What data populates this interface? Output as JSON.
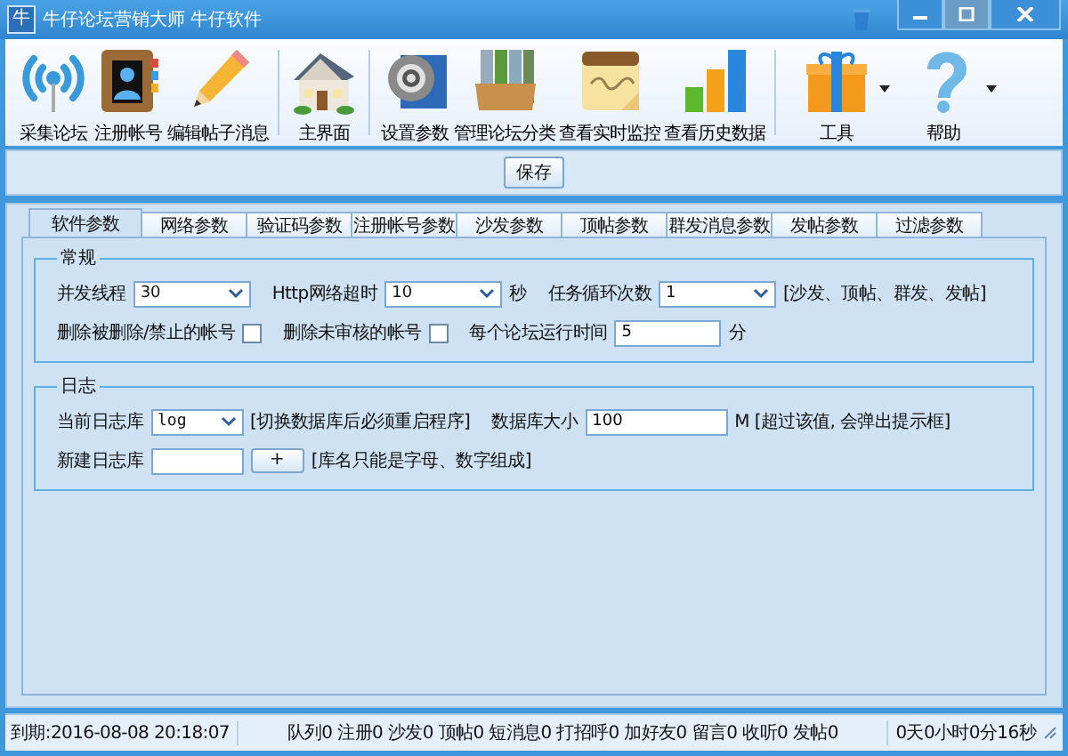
{
  "window": {
    "app_icon_text": "牛",
    "title": "牛仔论坛营销大师 牛仔软件"
  },
  "toolbar": {
    "groups": [
      [
        {
          "label": "采集论坛",
          "dropdown": false
        },
        {
          "label": "注册帐号",
          "dropdown": false
        },
        {
          "label": "编辑帖子消息",
          "dropdown": false
        }
      ],
      [
        {
          "label": "主界面",
          "dropdown": false
        }
      ],
      [
        {
          "label": "设置参数",
          "dropdown": false
        },
        {
          "label": "管理论坛分类",
          "dropdown": false
        },
        {
          "label": "查看实时监控",
          "dropdown": false
        },
        {
          "label": "查看历史数据",
          "dropdown": false
        }
      ],
      [
        {
          "label": "工具",
          "dropdown": true
        },
        {
          "label": "帮助",
          "dropdown": true
        }
      ]
    ]
  },
  "save_button": "保存",
  "tabs": [
    {
      "label": "软件参数",
      "selected": true
    },
    {
      "label": "网络参数",
      "selected": false
    },
    {
      "label": "验证码参数",
      "selected": false
    },
    {
      "label": "注册帐号参数",
      "selected": false
    },
    {
      "label": "沙发参数",
      "selected": false
    },
    {
      "label": "顶帖参数",
      "selected": false
    },
    {
      "label": "群发消息参数",
      "selected": false
    },
    {
      "label": "发帖参数",
      "selected": false
    },
    {
      "label": "过滤参数",
      "selected": false
    }
  ],
  "general": {
    "title": "常规",
    "threads": {
      "label": "并发线程",
      "value": "30"
    },
    "http_timeout": {
      "label": "Http网络超时",
      "value": "10",
      "unit": "秒"
    },
    "loop_count": {
      "label": "任务循环次数",
      "value": "1",
      "note": "[沙发、顶帖、群发、发帖]"
    },
    "delete_banned": {
      "label": "删除被删除/禁止的帐号",
      "checked": false
    },
    "delete_unreviewed": {
      "label": "删除未审核的帐号",
      "checked": false
    },
    "run_time": {
      "label": "每个论坛运行时间",
      "value": "5",
      "unit": "分"
    }
  },
  "log": {
    "title": "日志",
    "current_db": {
      "label": "当前日志库",
      "value": "log",
      "note": "[切换数据库后必须重启程序]"
    },
    "db_size": {
      "label": "数据库大小",
      "value": "100",
      "note": "M [超过该值, 会弹出提示框]"
    },
    "new_db": {
      "label": "新建日志库",
      "button": "+",
      "note": "[库名只能是字母、数字组成]"
    }
  },
  "status_bar": {
    "expiry": "到期:2016-08-08 20:18:07",
    "counters": "队列0 注册0 沙发0 顶帖0 短消息0 打招呼0 加好友0 留言0 收听0 发帖0",
    "uptime": "0天0小时0分16秒"
  }
}
